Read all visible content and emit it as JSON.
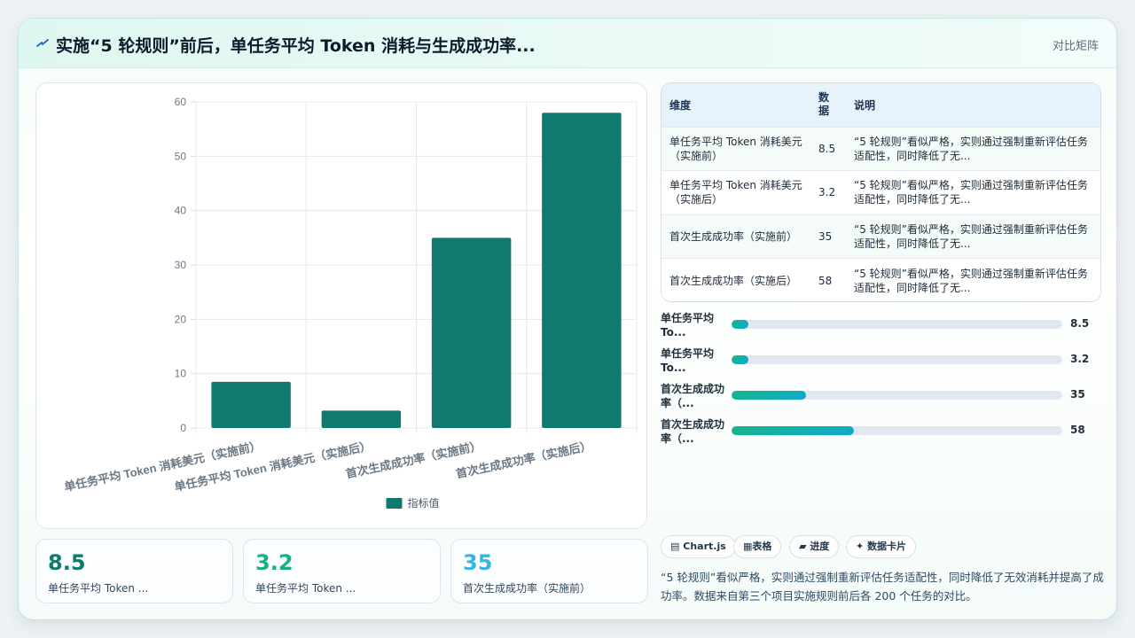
{
  "header": {
    "title": "实施“5 轮规则”前后，单任务平均 Token 消耗与生成成功率...",
    "right_label": "对比矩阵"
  },
  "chart_data": {
    "type": "bar",
    "categories": [
      "单任务平均 Token 消耗美元（实施前）",
      "单任务平均 Token 消耗美元（实施后）",
      "首次生成成功率（实施前）",
      "首次生成成功率（实施后）"
    ],
    "series": [
      {
        "name": "指标值",
        "values": [
          8.5,
          3.2,
          35,
          58
        ]
      }
    ],
    "ylim": [
      0,
      60
    ],
    "yticks": [
      0,
      10,
      20,
      30,
      40,
      50,
      60
    ],
    "grid": true,
    "legend": "bottom",
    "bar_color": "#117a6f"
  },
  "table": {
    "headers": [
      "维度",
      "数据",
      "说明"
    ],
    "rows": [
      {
        "dim": "单任务平均 Token 消耗美元（实施前）",
        "val": "8.5",
        "desc": "“5 轮规则”看似严格，实则通过强制重新评估任务适配性，同时降低了无..."
      },
      {
        "dim": "单任务平均 Token 消耗美元（实施后）",
        "val": "3.2",
        "desc": "“5 轮规则”看似严格，实则通过强制重新评估任务适配性，同时降低了无..."
      },
      {
        "dim": "首次生成成功率（实施前）",
        "val": "35",
        "desc": "“5 轮规则”看似严格，实则通过强制重新评估任务适配性，同时降低了无..."
      },
      {
        "dim": "首次生成成功率（实施后）",
        "val": "58",
        "desc": "“5 轮规则”看似严格，实则通过强制重新评估任务适配性，同时降低了无..."
      }
    ]
  },
  "progress": [
    {
      "label": "单任务平均 To...",
      "value": "8.5",
      "fraction": 0.05
    },
    {
      "label": "单任务平均 To...",
      "value": "3.2",
      "fraction": 0.05
    },
    {
      "label": "首次生成成功率（...",
      "value": "35",
      "fraction": 0.226
    },
    {
      "label": "首次生成成功率（...",
      "value": "58",
      "fraction": 0.37
    }
  ],
  "kpis": [
    {
      "value": "8.5",
      "label": "单任务平均 Token ...",
      "color": "#117a6f"
    },
    {
      "value": "3.2",
      "label": "单任务平均 Token ...",
      "color": "#16b083"
    },
    {
      "value": "35",
      "label": "首次生成成功率（实施前）",
      "color": "#38b6e0"
    }
  ],
  "tags": [
    {
      "icon": "▤",
      "label": "Chart.js"
    },
    {
      "icon": "▦",
      "label": "表格"
    },
    {
      "icon": "▰",
      "label": "进度"
    },
    {
      "icon": "✦",
      "label": "数据卡片"
    }
  ],
  "note": "“5 轮规则”看似严格，实则通过强制重新评估任务适配性，同时降低了无效消耗并提高了成功率。数据来自第三个项目实施规则前后各 200 个任务的对比。"
}
